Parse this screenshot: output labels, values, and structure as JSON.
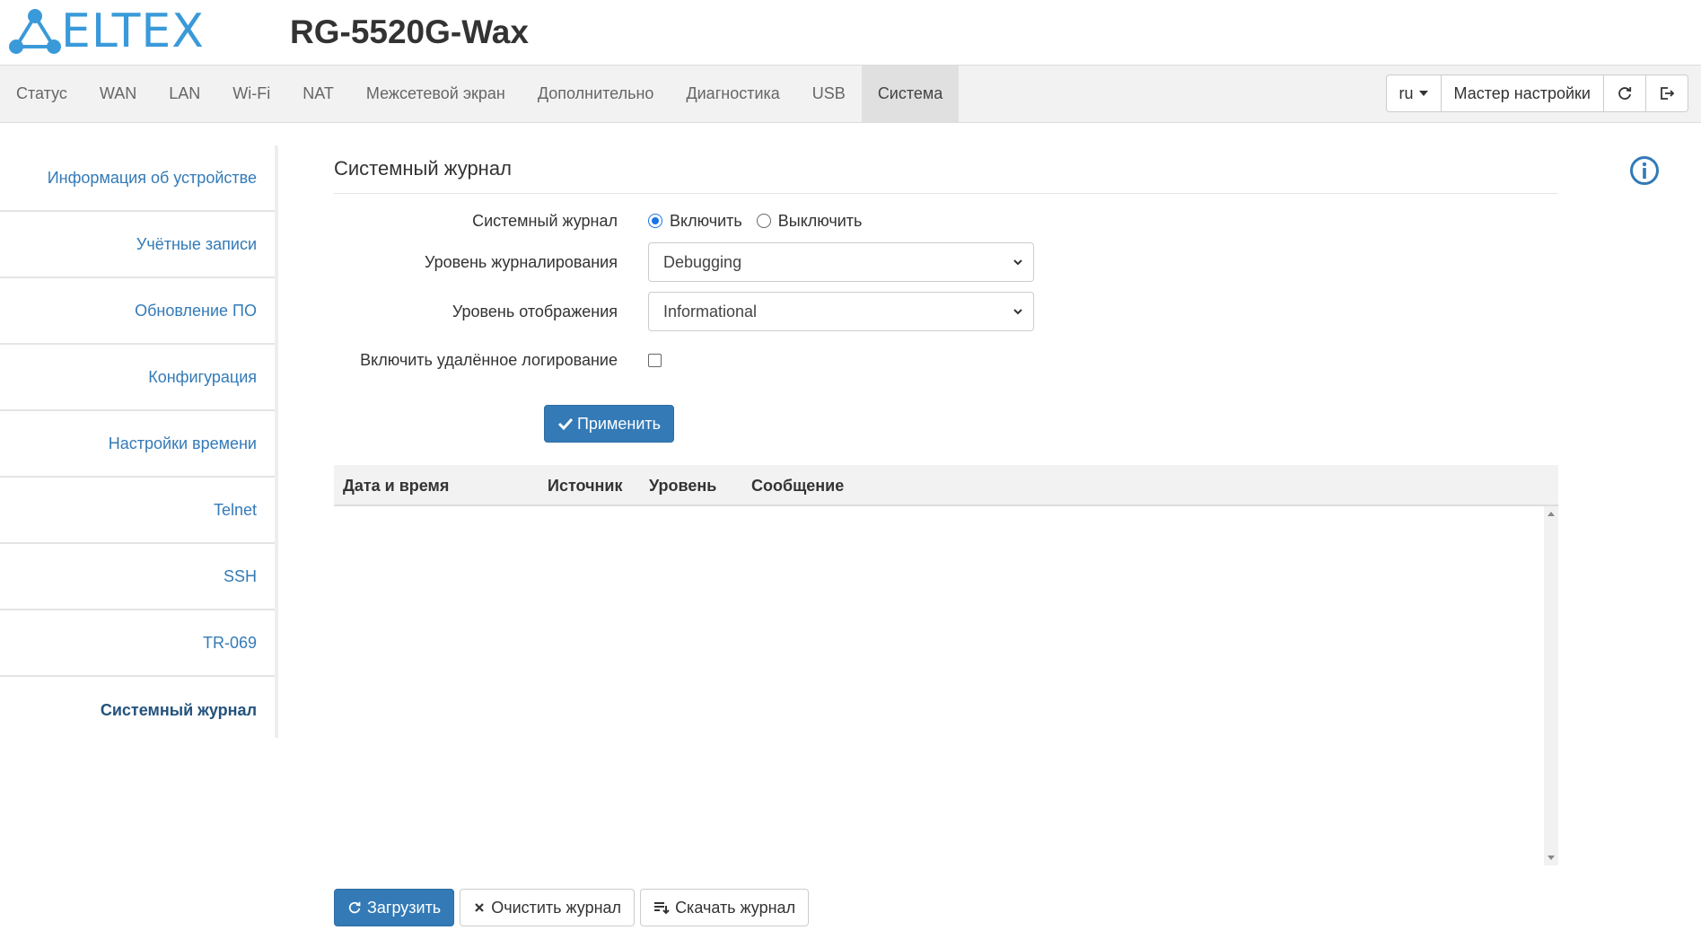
{
  "header": {
    "logo_text": "ELTEX",
    "device_title": "RG-5520G-Wax"
  },
  "nav": {
    "items": [
      "Статус",
      "WAN",
      "LAN",
      "Wi-Fi",
      "NAT",
      "Межсетевой экран",
      "Дополнительно",
      "Диагностика",
      "USB",
      "Система"
    ],
    "active": "Система",
    "lang": "ru",
    "wizard": "Мастер настройки"
  },
  "sidebar": {
    "items": [
      "Информация об устройстве",
      "Учётные записи",
      "Обновление ПО",
      "Конфигурация",
      "Настройки времени",
      "Telnet",
      "SSH",
      "TR-069",
      "Системный журнал"
    ],
    "active": "Системный журнал"
  },
  "form": {
    "title": "Системный журнал",
    "syslog_label": "Системный журнал",
    "enable_label": "Включить",
    "disable_label": "Выключить",
    "log_level_label": "Уровень журналирования",
    "log_level_value": "Debugging",
    "display_level_label": "Уровень отображения",
    "display_level_value": "Informational",
    "remote_label": "Включить удалённое логирование",
    "apply_label": "Применить"
  },
  "log_table": {
    "columns": [
      "Дата и время",
      "Источник",
      "Уровень",
      "Сообщение"
    ]
  },
  "actions": {
    "load": "Загрузить",
    "clear": "Очистить журнал",
    "download": "Скачать журнал"
  },
  "colors": {
    "brand": "#3a9ad9",
    "primary": "#337ab7",
    "link": "#337ab7"
  }
}
